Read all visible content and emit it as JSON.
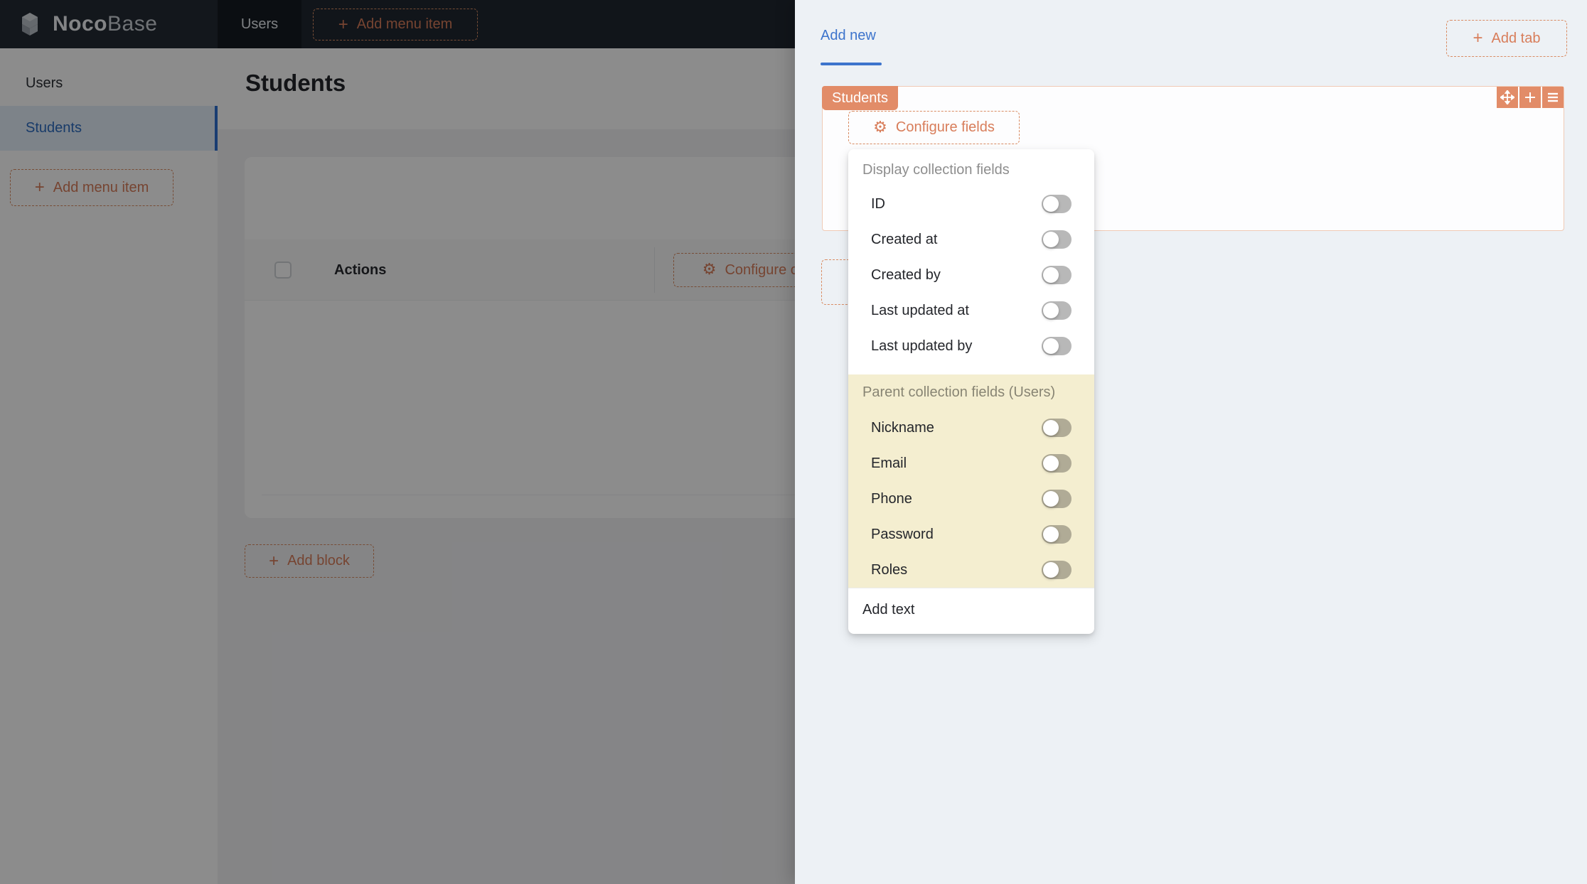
{
  "navbar": {
    "brand": {
      "part1": "Noco",
      "part2": "Base"
    },
    "menu": [
      {
        "label": "Users",
        "selected": true
      }
    ],
    "add_menu_item_label": "Add menu item"
  },
  "sidebar": {
    "menu": [
      {
        "label": "Users",
        "selected": false
      },
      {
        "label": "Students",
        "selected": true
      }
    ],
    "add_menu_item_label": "Add menu item"
  },
  "main": {
    "page_title": "Students",
    "table": {
      "select_all_checked": false,
      "column_header": "Actions",
      "configure_columns_label": "Configure columns"
    },
    "add_block_label": "Add block"
  },
  "drawer": {
    "active_tab": "Add new",
    "add_tab_label": "Add tab",
    "block": {
      "tag": "Students",
      "configure_fields_label": "Configure fields",
      "toolbar_icons": [
        "drag-move-icon",
        "plus-icon",
        "menu-icon"
      ]
    },
    "dropdown": {
      "sections": [
        {
          "header": "Display collection fields",
          "items": [
            {
              "label": "ID",
              "enabled": false
            },
            {
              "label": "Created at",
              "enabled": false
            },
            {
              "label": "Created by",
              "enabled": false
            },
            {
              "label": "Last updated at",
              "enabled": false
            },
            {
              "label": "Last updated by",
              "enabled": false
            }
          ]
        },
        {
          "header": "Parent collection fields (Users)",
          "items": [
            {
              "label": "Nickname",
              "enabled": false
            },
            {
              "label": "Email",
              "enabled": false
            },
            {
              "label": "Phone",
              "enabled": false
            },
            {
              "label": "Password",
              "enabled": false
            },
            {
              "label": "Roles",
              "enabled": false
            }
          ]
        }
      ],
      "footer_label": "Add text"
    }
  },
  "icons": {
    "plus": "+",
    "gear": "⚙"
  },
  "colors": {
    "accent_orange": "#d87d5a",
    "tag_orange": "#e28c68",
    "link_blue": "#3d74cc",
    "sidebar_selected_bg": "#e3eefa",
    "yellow_section_bg": "#f4eed0",
    "drawer_bg": "#edf1f5",
    "navbar_bg": "#1f2731"
  }
}
